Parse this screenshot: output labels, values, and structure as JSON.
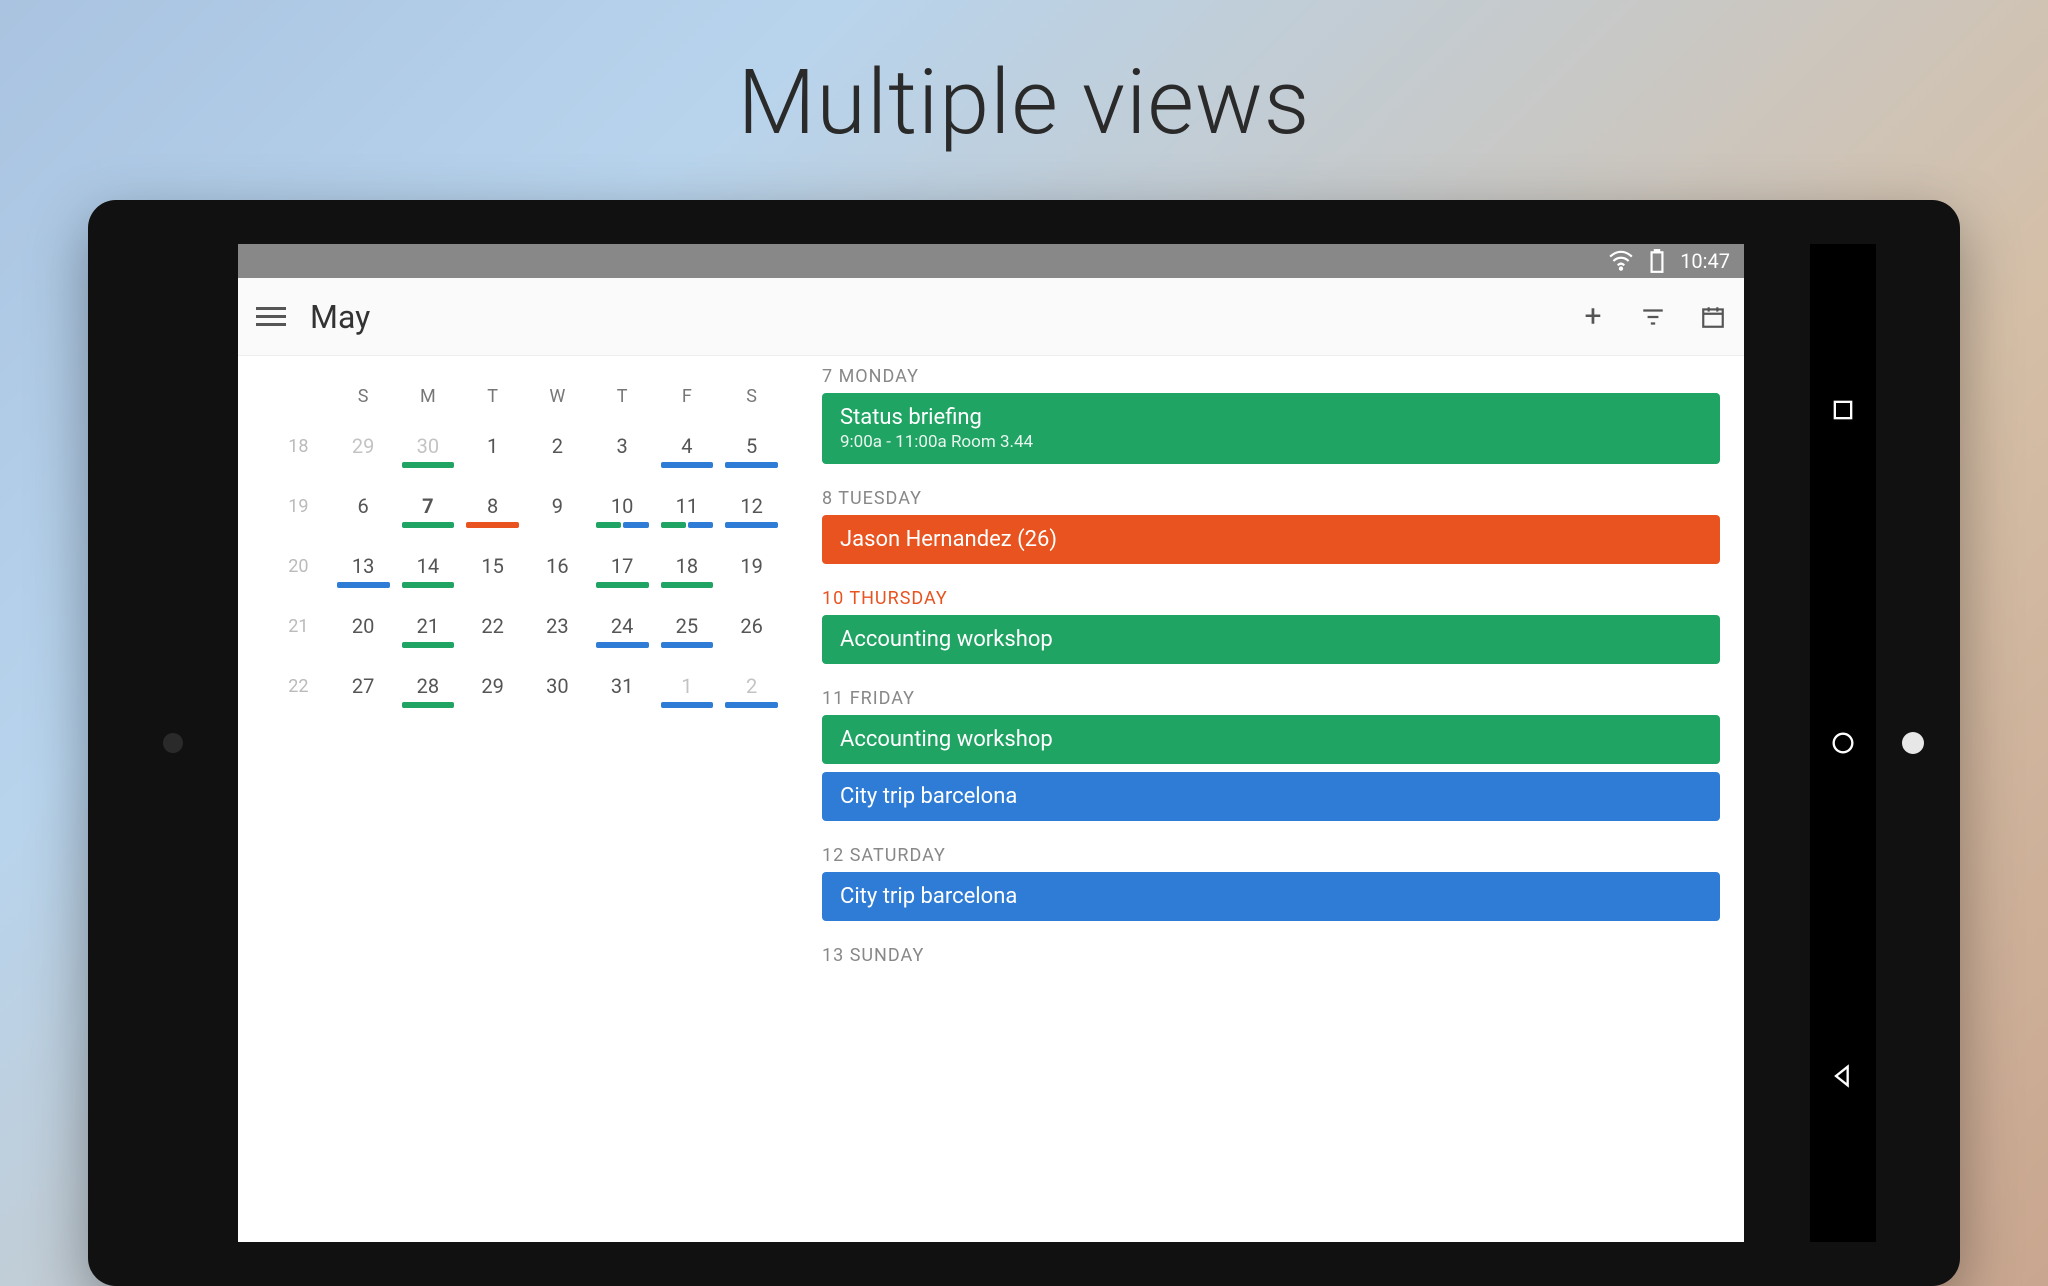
{
  "promo": {
    "title": "Multiple views"
  },
  "statusbar": {
    "time": "10:47"
  },
  "appbar": {
    "title": "May",
    "add": "+",
    "filter": "filter",
    "today": "today"
  },
  "month": {
    "headers": [
      "",
      "S",
      "M",
      "T",
      "W",
      "T",
      "F",
      "S"
    ],
    "rows": [
      {
        "wk": "18",
        "days": [
          {
            "n": "29",
            "muted": true
          },
          {
            "n": "30",
            "muted": true,
            "bars": [
              "g"
            ]
          },
          {
            "n": "1"
          },
          {
            "n": "2"
          },
          {
            "n": "3"
          },
          {
            "n": "4",
            "bars": [
              "b"
            ]
          },
          {
            "n": "5",
            "bars": [
              "b"
            ]
          }
        ]
      },
      {
        "wk": "19",
        "days": [
          {
            "n": "6"
          },
          {
            "n": "7",
            "sel": true,
            "bars": [
              "g"
            ]
          },
          {
            "n": "8",
            "bars": [
              "o"
            ]
          },
          {
            "n": "9"
          },
          {
            "n": "10",
            "bars": [
              "g",
              "b"
            ]
          },
          {
            "n": "11",
            "bars": [
              "g",
              "b"
            ]
          },
          {
            "n": "12",
            "bars": [
              "b"
            ]
          }
        ]
      },
      {
        "wk": "20",
        "days": [
          {
            "n": "13",
            "bars": [
              "b"
            ]
          },
          {
            "n": "14",
            "bars": [
              "g"
            ]
          },
          {
            "n": "15"
          },
          {
            "n": "16"
          },
          {
            "n": "17",
            "bars": [
              "g"
            ]
          },
          {
            "n": "18",
            "bars": [
              "g"
            ]
          },
          {
            "n": "19"
          }
        ]
      },
      {
        "wk": "21",
        "days": [
          {
            "n": "20"
          },
          {
            "n": "21",
            "bars": [
              "g"
            ]
          },
          {
            "n": "22"
          },
          {
            "n": "23"
          },
          {
            "n": "24",
            "bars": [
              "b"
            ]
          },
          {
            "n": "25",
            "bars": [
              "b"
            ]
          },
          {
            "n": "26"
          }
        ]
      },
      {
        "wk": "22",
        "days": [
          {
            "n": "27"
          },
          {
            "n": "28",
            "bars": [
              "g"
            ]
          },
          {
            "n": "29"
          },
          {
            "n": "30"
          },
          {
            "n": "31"
          },
          {
            "n": "1",
            "muted": true,
            "bars": [
              "b"
            ]
          },
          {
            "n": "2",
            "muted": true,
            "bars": [
              "b"
            ]
          }
        ]
      }
    ]
  },
  "agenda": [
    {
      "label": "7 MONDAY",
      "events": [
        {
          "title": "Status briefing",
          "sub": "9:00a - 11:00a Room 3.44",
          "color": "g"
        }
      ]
    },
    {
      "label": "8 TUESDAY",
      "events": [
        {
          "title": "Jason Hernandez (26)",
          "color": "o"
        }
      ]
    },
    {
      "label": "10 THURSDAY",
      "hot": true,
      "events": [
        {
          "title": "Accounting workshop",
          "color": "g"
        }
      ]
    },
    {
      "label": "11 FRIDAY",
      "events": [
        {
          "title": "Accounting workshop",
          "color": "g"
        },
        {
          "title": "City trip barcelona",
          "color": "b"
        }
      ]
    },
    {
      "label": "12 SATURDAY",
      "events": [
        {
          "title": "City trip barcelona",
          "color": "b"
        }
      ]
    },
    {
      "label": "13 SUNDAY",
      "events": []
    }
  ]
}
